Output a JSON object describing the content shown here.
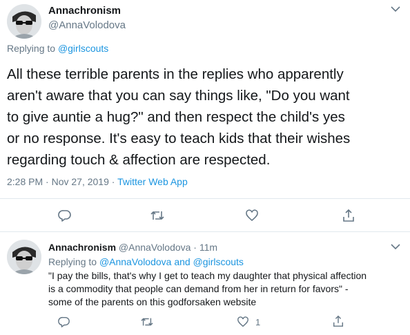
{
  "main_tweet": {
    "display_name": "Annachronism",
    "handle": "@AnnaVolodova",
    "replying_prefix": "Replying to ",
    "replying_to": "@girlscouts",
    "text": "All these terrible parents in the replies who apparently\naren't aware that you can say things like, \"Do you want\nto give auntie a hug?\" and then respect the child's yes\nor no response. It's easy to teach kids that their wishes\nregarding touch & affection are respected.",
    "time": "2:28 PM · Nov 27, 2019",
    "separator": " · ",
    "source": "Twitter Web App",
    "actions": [
      "reply-icon",
      "retweet-icon",
      "like-icon",
      "share-icon"
    ]
  },
  "reply_tweet": {
    "display_name": "Annachronism",
    "handle": "@AnnaVolodova",
    "age": " · 11m",
    "replying_prefix": "Replying to ",
    "replying_to": "@AnnaVolodova and @girlscouts",
    "text": "\"I pay the bills, that's why I get to teach my daughter that physical affection\nis a commodity that people can demand from her in return for favors\" -\nsome of the parents on this godforsaken website",
    "like_count": "1",
    "actions": [
      "reply-icon",
      "retweet-icon",
      "like-icon",
      "share-icon"
    ]
  },
  "colors": {
    "text": "#14171a",
    "muted": "#657786",
    "link": "#1b95e0",
    "divider": "#e1e8ed"
  }
}
